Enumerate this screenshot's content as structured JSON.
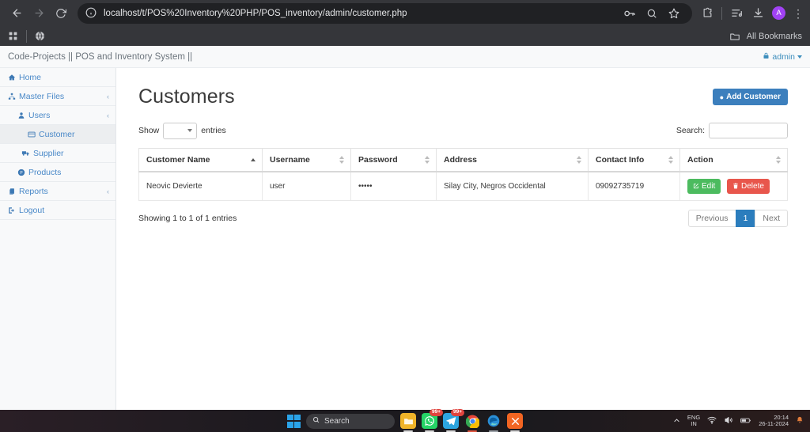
{
  "browser": {
    "url": "localhost/t/POS%20Inventory%20PHP/POS_inventory/admin/customer.php",
    "back_icon": "back-arrow-icon",
    "forward_icon": "forward-arrow-icon",
    "reload_icon": "reload-icon",
    "site_info_icon": "site-info-icon",
    "password_icon": "password-key-icon",
    "zoom_icon": "search-zoom-icon",
    "bookmark_star_icon": "bookmark-star-icon",
    "extensions_icon": "extensions-puzzle-icon",
    "reading_list_icon": "reading-list-icon",
    "downloads_icon": "downloads-icon",
    "profile_initial": "A",
    "menu_icon": "kebab-menu-icon",
    "bookmarks": {
      "apps_icon": "apps-grid-icon",
      "site_icon": "globe-bookmark-icon",
      "folder_icon": "folder-icon",
      "all_bookmarks_label": "All Bookmarks"
    }
  },
  "topnav": {
    "brand": "Code-Projects || POS and Inventory System ||",
    "user_label": "admin",
    "lock_icon": "lock-icon",
    "caret_icon": "caret-down-icon"
  },
  "sidebar": {
    "items": [
      {
        "label": "Home",
        "icon": "home-icon",
        "level": 1,
        "arrow": "",
        "active": false
      },
      {
        "label": "Master Files",
        "icon": "sitemap-icon",
        "level": 1,
        "arrow": "‹",
        "active": false
      },
      {
        "label": "Users",
        "icon": "user-icon",
        "level": 2,
        "arrow": "‹",
        "active": false
      },
      {
        "label": "Customer",
        "icon": "id-card-icon",
        "level": 3,
        "arrow": "",
        "active": true
      },
      {
        "label": "Supplier",
        "icon": "truck-icon",
        "level": 2,
        "arrow": "",
        "active": false
      },
      {
        "label": "Products",
        "icon": "product-circle-icon",
        "level": 2,
        "arrow": "",
        "active": false
      },
      {
        "label": "Reports",
        "icon": "reports-icon",
        "level": 1,
        "arrow": "‹",
        "active": false
      },
      {
        "label": "Logout",
        "icon": "logout-icon",
        "level": 1,
        "arrow": "",
        "active": false
      }
    ]
  },
  "main": {
    "page_title": "Customers",
    "add_button_label": "Add Customer",
    "add_button_icon": "plus-circle-icon",
    "accent_color": "#3c7fbd",
    "show_label": "Show",
    "entries_label": "entries",
    "entries_value": "",
    "search_label": "Search:",
    "search_value": "",
    "search_placeholder": "",
    "columns": [
      {
        "label": "Customer Name",
        "sort": "asc"
      },
      {
        "label": "Username",
        "sort": "none"
      },
      {
        "label": "Password",
        "sort": "none"
      },
      {
        "label": "Address",
        "sort": "none"
      },
      {
        "label": "Contact Info",
        "sort": "none"
      },
      {
        "label": "Action",
        "sort": "none"
      }
    ],
    "rows": [
      {
        "customer_name": "Neovic Devierte",
        "username": "user",
        "password": "•••••",
        "address": "Silay City, Negros Occidental",
        "contact_info": "09092735719",
        "edit_label": "Edit",
        "edit_icon": "pencil-square-icon",
        "edit_color": "#4cbb5f",
        "delete_label": "Delete",
        "delete_icon": "trash-icon",
        "delete_color": "#e8564c"
      }
    ],
    "info_text": "Showing 1 to 1 of 1 entries",
    "pagination": {
      "previous_label": "Previous",
      "pages": [
        "1"
      ],
      "next_label": "Next",
      "active_page": "1",
      "active_color": "#2b7dbd"
    }
  },
  "taskbar": {
    "start_icon": "windows-start-icon",
    "search_placeholder": "Search",
    "search_icon": "search-icon",
    "apps": [
      {
        "name": "file-explorer-icon",
        "badge": "",
        "color": "#f0b429"
      },
      {
        "name": "whatsapp-icon",
        "badge": "99+",
        "color": "#25d366"
      },
      {
        "name": "telegram-icon",
        "badge": "99+",
        "color": "#2ca5e0"
      },
      {
        "name": "chrome-icon",
        "badge": "",
        "color": "#4285f4"
      },
      {
        "name": "edge-icon",
        "badge": "",
        "color": "#0f9bd7"
      },
      {
        "name": "xampp-icon",
        "badge": "",
        "color": "#f26522"
      }
    ],
    "chevron_icon": "show-hidden-icons-icon",
    "language": "ENG",
    "language_region": "IN",
    "wifi_icon": "wifi-icon",
    "volume_icon": "volume-icon",
    "battery_icon": "battery-icon",
    "time": "20:14",
    "date": "26-11-2024",
    "notification_icon": "notification-bell-icon"
  }
}
